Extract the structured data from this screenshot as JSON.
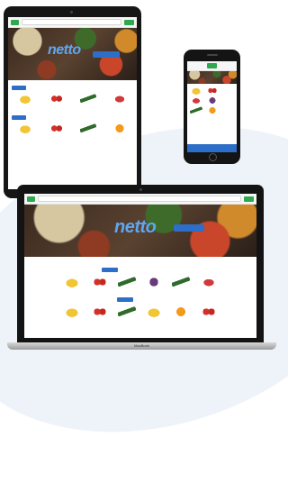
{
  "brand": {
    "logo": "netto",
    "accent": "#2d6ec9",
    "green": "#2fa84f",
    "logo_color": "#5ea6f2"
  },
  "devices": {
    "tablet": {
      "name": "tablet"
    },
    "phone": {
      "name": "phone"
    },
    "laptop": {
      "name": "laptop",
      "base_label": "MacBook"
    }
  },
  "page": {
    "search_placeholder": "",
    "cta_label": "",
    "sort_options": [
      "",
      "",
      ""
    ],
    "tabs": [
      "",
      "",
      "",
      "",
      "",
      ""
    ],
    "products": [
      {
        "icon": "banana",
        "name": "",
        "price": ""
      },
      {
        "icon": "tomato",
        "name": "",
        "price": ""
      },
      {
        "icon": "cucumber",
        "name": "",
        "price": ""
      },
      {
        "icon": "pepper",
        "name": "",
        "price": ""
      }
    ],
    "products_row2": [
      {
        "icon": "banana",
        "name": "",
        "price": ""
      },
      {
        "icon": "tomato",
        "name": "",
        "price": ""
      },
      {
        "icon": "cucumber",
        "name": "",
        "price": ""
      },
      {
        "icon": "orange",
        "name": "",
        "price": ""
      }
    ],
    "laptop_products": [
      {
        "icon": "banana",
        "name": "",
        "price": ""
      },
      {
        "icon": "tomato",
        "name": "",
        "price": ""
      },
      {
        "icon": "cucumber",
        "name": "",
        "price": ""
      },
      {
        "icon": "grape",
        "name": "",
        "price": ""
      },
      {
        "icon": "cucumber",
        "name": "",
        "price": ""
      },
      {
        "icon": "pepper",
        "name": "",
        "price": ""
      }
    ],
    "laptop_products_row2": [
      {
        "icon": "banana",
        "name": "",
        "price": ""
      },
      {
        "icon": "tomato",
        "name": "",
        "price": ""
      },
      {
        "icon": "cucumber",
        "name": "",
        "price": ""
      },
      {
        "icon": "banana",
        "name": "",
        "price": ""
      },
      {
        "icon": "orange",
        "name": "",
        "price": ""
      },
      {
        "icon": "tomato",
        "name": "",
        "price": ""
      }
    ],
    "phone_cart_label": ""
  }
}
